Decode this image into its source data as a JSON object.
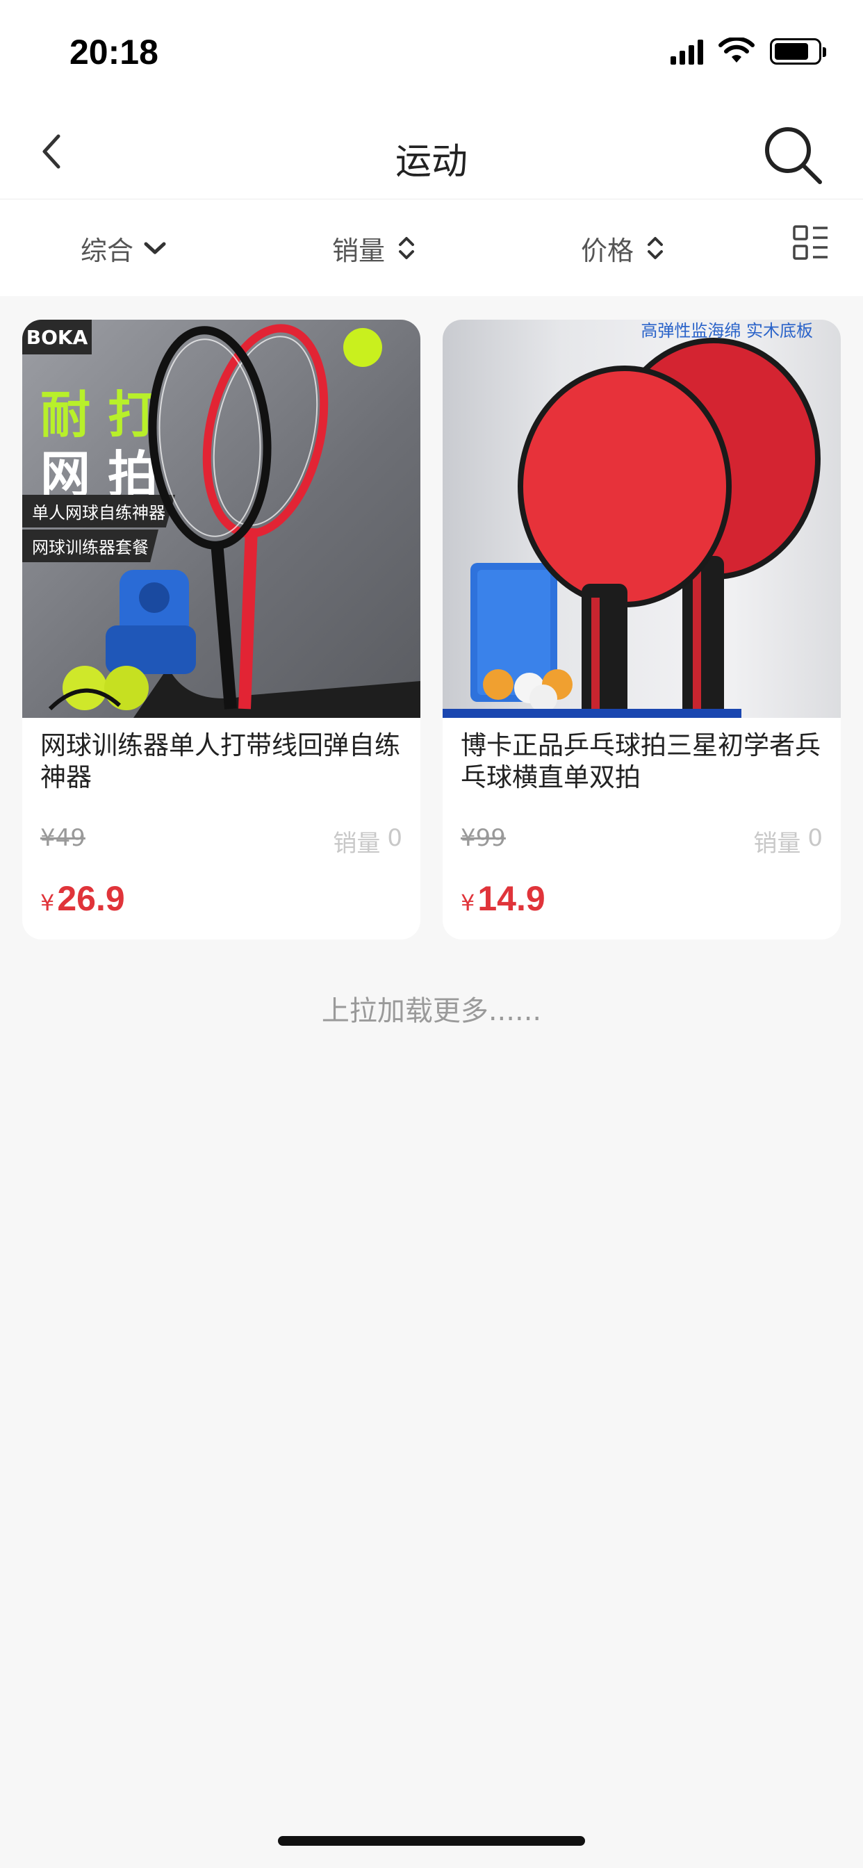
{
  "status_bar": {
    "time": "20:18"
  },
  "nav": {
    "title": "运动"
  },
  "filters": [
    {
      "label": "综合",
      "icon": "chevron-down-icon"
    },
    {
      "label": "销量",
      "icon": "sort-updown-icon"
    },
    {
      "label": "价格",
      "icon": "sort-updown-icon"
    }
  ],
  "products": [
    {
      "title": "网球训练器单人打带线回弹自练神器",
      "original_price": "¥49",
      "sales_label": "销量",
      "sales_count": "0",
      "currency": "¥",
      "price": "26.9",
      "image": {
        "brand": "BOKA",
        "headline_1": "耐 打",
        "headline_2": "网 拍",
        "tag_1": "单人网球自练神器",
        "tag_2": "网球训练器套餐"
      }
    },
    {
      "title": "博卡正品乒乓球拍三星初学者兵乓球横直单双拍",
      "original_price": "¥99",
      "sales_label": "销量",
      "sales_count": "0",
      "currency": "¥",
      "price": "14.9",
      "image": {
        "caption": "高弹性监海绵 实木底板"
      }
    }
  ],
  "footer": {
    "load_more": "上拉加载更多......"
  },
  "colors": {
    "accent_price": "#e0343a",
    "background": "#f7f7f7",
    "card": "#ffffff"
  }
}
